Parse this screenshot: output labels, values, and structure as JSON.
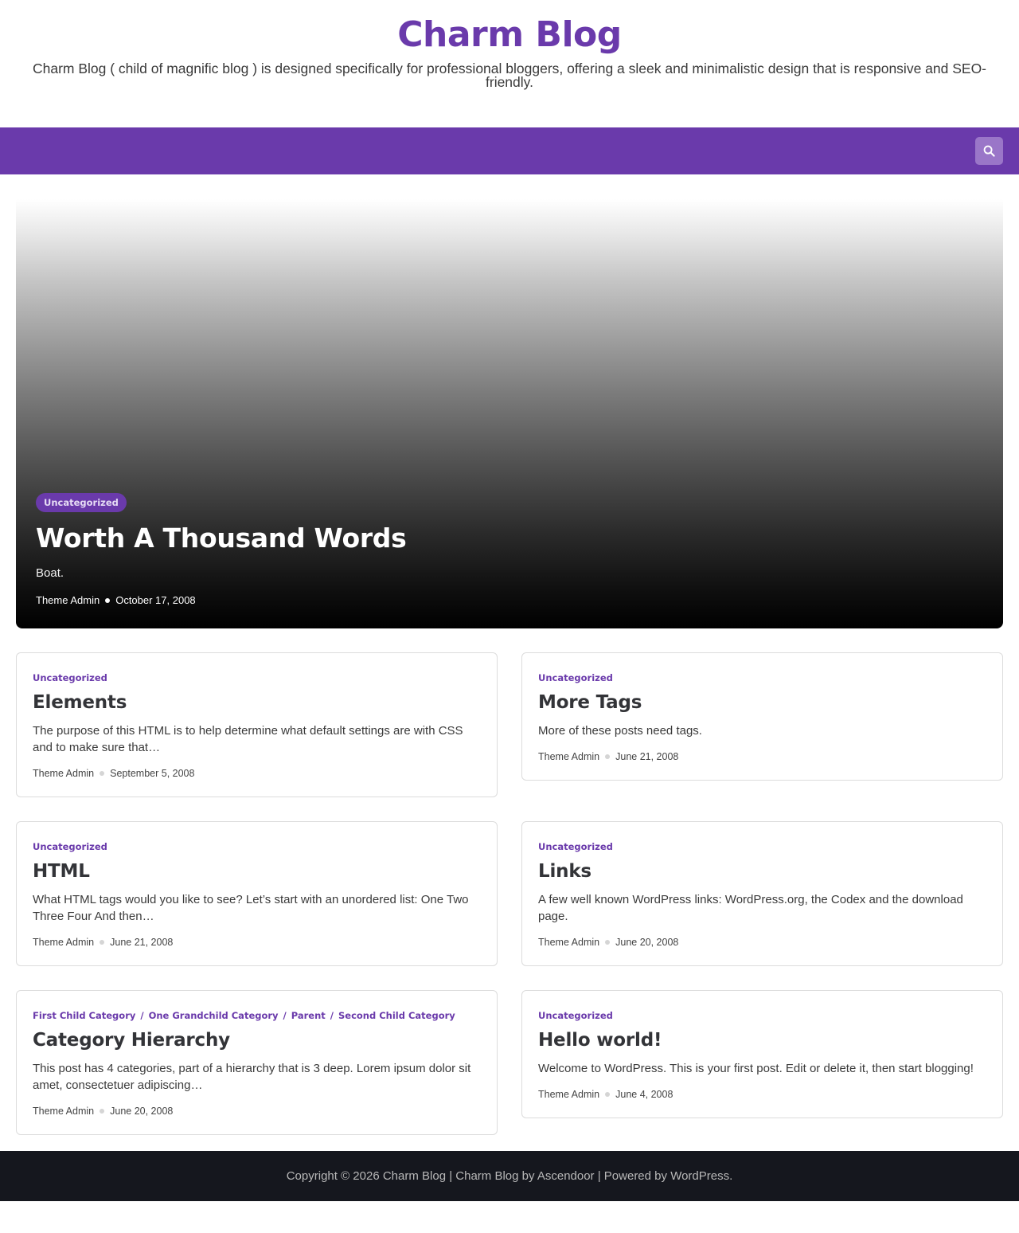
{
  "header": {
    "site_title": "Charm Blog",
    "site_description": "Charm Blog ( child of magnific blog ) is designed specifically for professional bloggers, offering a sleek and minimalistic design that is responsive and SEO-friendly."
  },
  "nav": {
    "search_icon": "search-icon",
    "accent_color": "#6a3aab"
  },
  "hero": {
    "category": "Uncategorized",
    "title": "Worth A Thousand Words",
    "excerpt": "Boat.",
    "author": "Theme Admin",
    "date": "October 17, 2008"
  },
  "posts": [
    {
      "categories": [
        "Uncategorized"
      ],
      "title": "Elements",
      "excerpt": "The purpose of this HTML is to help determine what default settings are with CSS and to make sure that…",
      "author": "Theme Admin",
      "date": "September 5, 2008"
    },
    {
      "categories": [
        "Uncategorized"
      ],
      "title": "More Tags",
      "excerpt": "More of these posts need tags.",
      "author": "Theme Admin",
      "date": "June 21, 2008"
    },
    {
      "categories": [
        "Uncategorized"
      ],
      "title": "HTML",
      "excerpt": "What HTML tags would you like to see? Let’s start with an unordered list: One Two Three Four And then…",
      "author": "Theme Admin",
      "date": "June 21, 2008"
    },
    {
      "categories": [
        "Uncategorized"
      ],
      "title": "Links",
      "excerpt": "A few well known WordPress links: WordPress.org, the Codex and the download page.",
      "author": "Theme Admin",
      "date": "June 20, 2008"
    },
    {
      "categories": [
        "First Child Category",
        "One Grandchild Category",
        "Parent",
        "Second Child Category"
      ],
      "title": "Category Hierarchy",
      "excerpt": "This post has 4 categories, part of a hierarchy that is 3 deep. Lorem ipsum dolor sit amet, consectetuer adipiscing…",
      "author": "Theme Admin",
      "date": "June 20, 2008"
    },
    {
      "categories": [
        "Uncategorized"
      ],
      "title": "Hello world!",
      "excerpt": "Welcome to WordPress. This is your first post. Edit or delete it, then start blogging!",
      "author": "Theme Admin",
      "date": "June 4, 2008"
    }
  ],
  "category_separator": "/",
  "footer": {
    "copyright": "Copyright © 2026 Charm Blog | ",
    "theme_link": "Charm Blog",
    "by_text": " by ",
    "author_link": "Ascendoor",
    "powered_text": " | Powered by ",
    "wp_link": "WordPress",
    "end": "."
  }
}
